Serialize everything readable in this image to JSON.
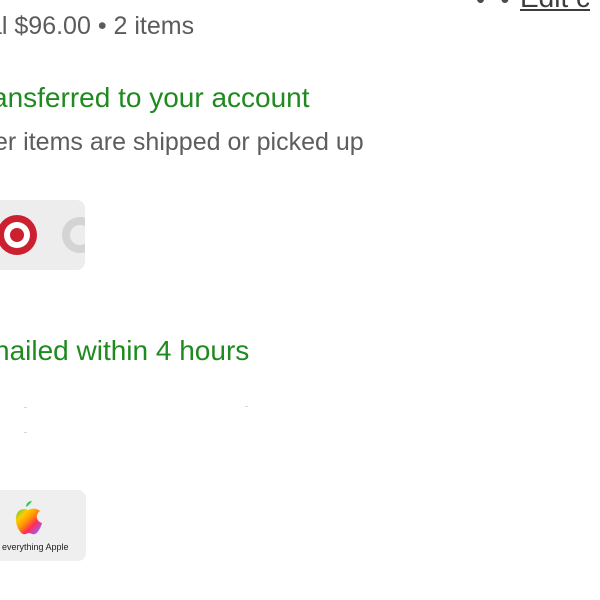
{
  "header": {
    "title_fragment": "",
    "dots": "• •",
    "edit_label": "Edit c"
  },
  "order": {
    "summary": "al $96.00 • 2 items"
  },
  "sections": [
    {
      "status": "ansferred to your account",
      "description": "er items are shipped or picked up",
      "card": "target"
    },
    {
      "status": "nailed within 4 hours",
      "card": "apple",
      "card_caption": "everything Apple"
    }
  ],
  "colors": {
    "status_green": "#1f8a1f",
    "text_gray": "#5b5b5b",
    "card_bg": "#ededed",
    "target_red": "#cc1f2f"
  }
}
